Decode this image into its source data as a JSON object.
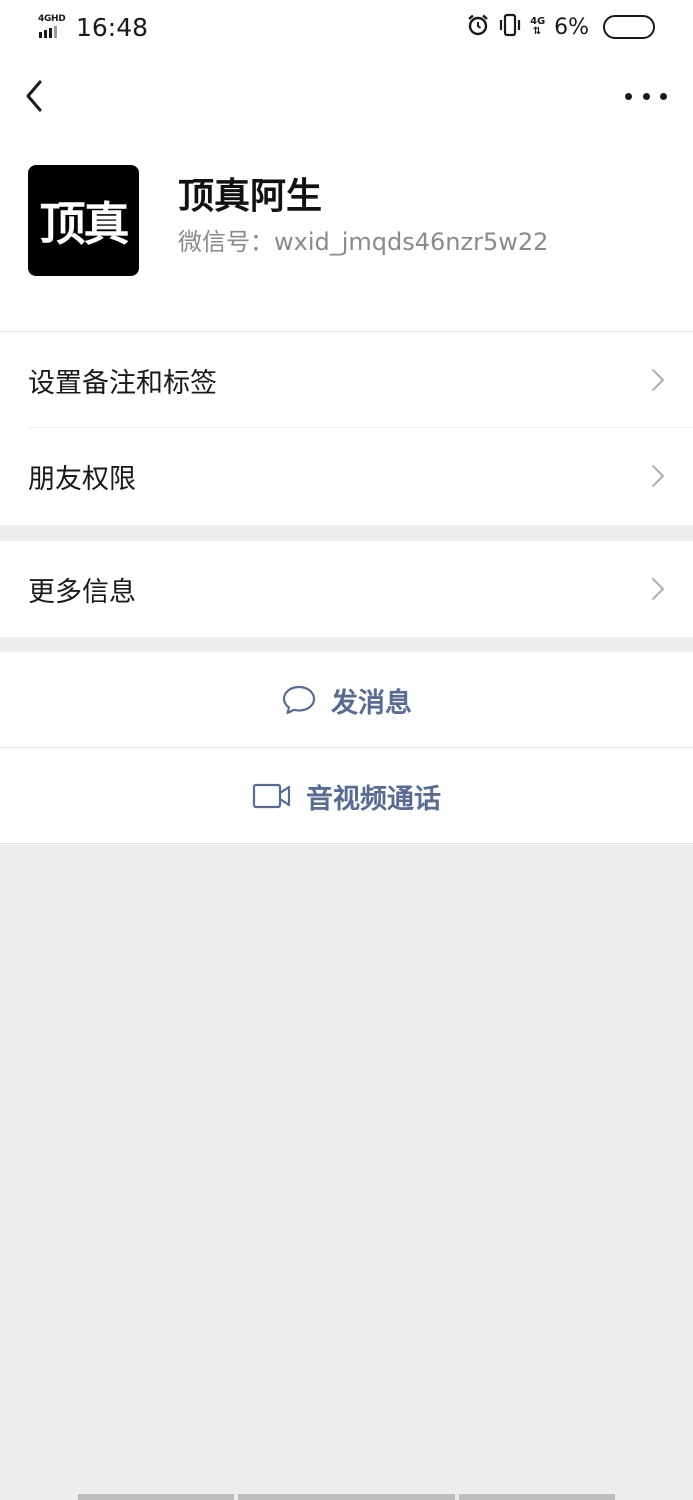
{
  "status_bar": {
    "network_label": "4GHD",
    "time": "16:48",
    "network_right": "4G",
    "battery": "6%",
    "icons": [
      "signal-icon",
      "alarm-icon",
      "vibrate-icon",
      "network-icon",
      "battery-icon"
    ]
  },
  "nav": {
    "back_icon": "chevron-left-icon",
    "more_icon": "more-dots-icon"
  },
  "profile": {
    "avatar_text": "顶真",
    "name": "顶真阿生",
    "wxid": "微信号：wxid_jmqds46nzr5w22"
  },
  "menu_group_1": [
    {
      "label": "设置备注和标签"
    },
    {
      "label": "朋友权限"
    }
  ],
  "menu_group_2": [
    {
      "label": "更多信息"
    }
  ],
  "actions": [
    {
      "label": "发消息",
      "icon": "chat-bubble-icon"
    },
    {
      "label": "音视频通话",
      "icon": "video-camera-icon"
    }
  ],
  "colors": {
    "background": "#ededed",
    "surface": "#ffffff",
    "action_text": "#576b95",
    "secondary_text": "#8a8a8a"
  }
}
